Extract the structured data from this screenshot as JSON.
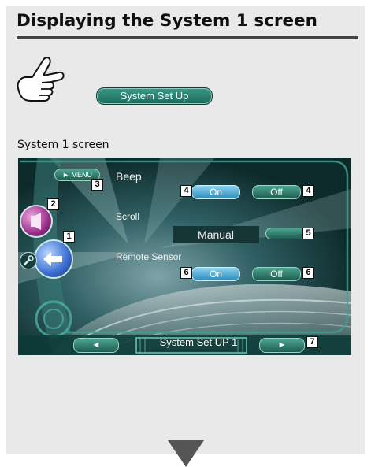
{
  "section_title": "Displaying the System 1 screen",
  "system_setup_button": "System Set Up",
  "caption": "System 1 screen",
  "screen": {
    "menu_button": "MENU",
    "beep": {
      "label": "Beep",
      "on": "On",
      "off": "Off"
    },
    "scroll": {
      "label": "Scroll",
      "value": "Manual"
    },
    "remote_sensor": {
      "label": "Remote Sensor",
      "on": "On",
      "off": "Off"
    },
    "footer_label": "System Set UP 1"
  },
  "callouts": {
    "c1": "1",
    "c2": "2",
    "c3": "3",
    "c4a": "4",
    "c4b": "4",
    "c5": "5",
    "c6a": "6",
    "c6b": "6",
    "c7": "7"
  },
  "colors": {
    "panel_bg": "#e9e9e9",
    "button_teal": "#2a7f6e",
    "on_button_blue": "#2a8dbb",
    "screen_bg": "#0d2a2a"
  },
  "icons": [
    "hand-pointer-icon",
    "down-triangle-icon",
    "sound-icon",
    "back-arrow-icon",
    "wrench-icon"
  ]
}
